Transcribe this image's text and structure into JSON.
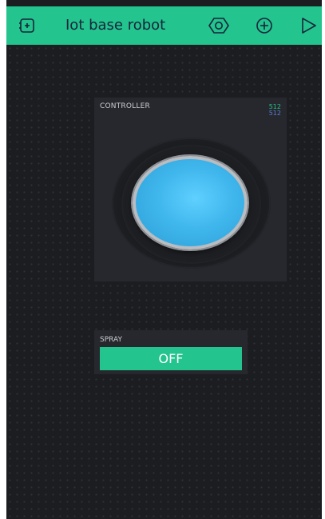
{
  "app": {
    "title": "Iot base robot",
    "accent_color": "#23c48e",
    "icons": {
      "device": "device-icon",
      "settings": "hexagon-settings-icon",
      "add": "add-widget-icon",
      "play": "play-icon"
    }
  },
  "controller": {
    "label": "CONTROLLER",
    "x_value": "512",
    "y_value": "512",
    "x_color": "#23c48e",
    "y_color": "#5f7cd8"
  },
  "spray": {
    "label": "SPRAY",
    "button_label": "OFF"
  }
}
